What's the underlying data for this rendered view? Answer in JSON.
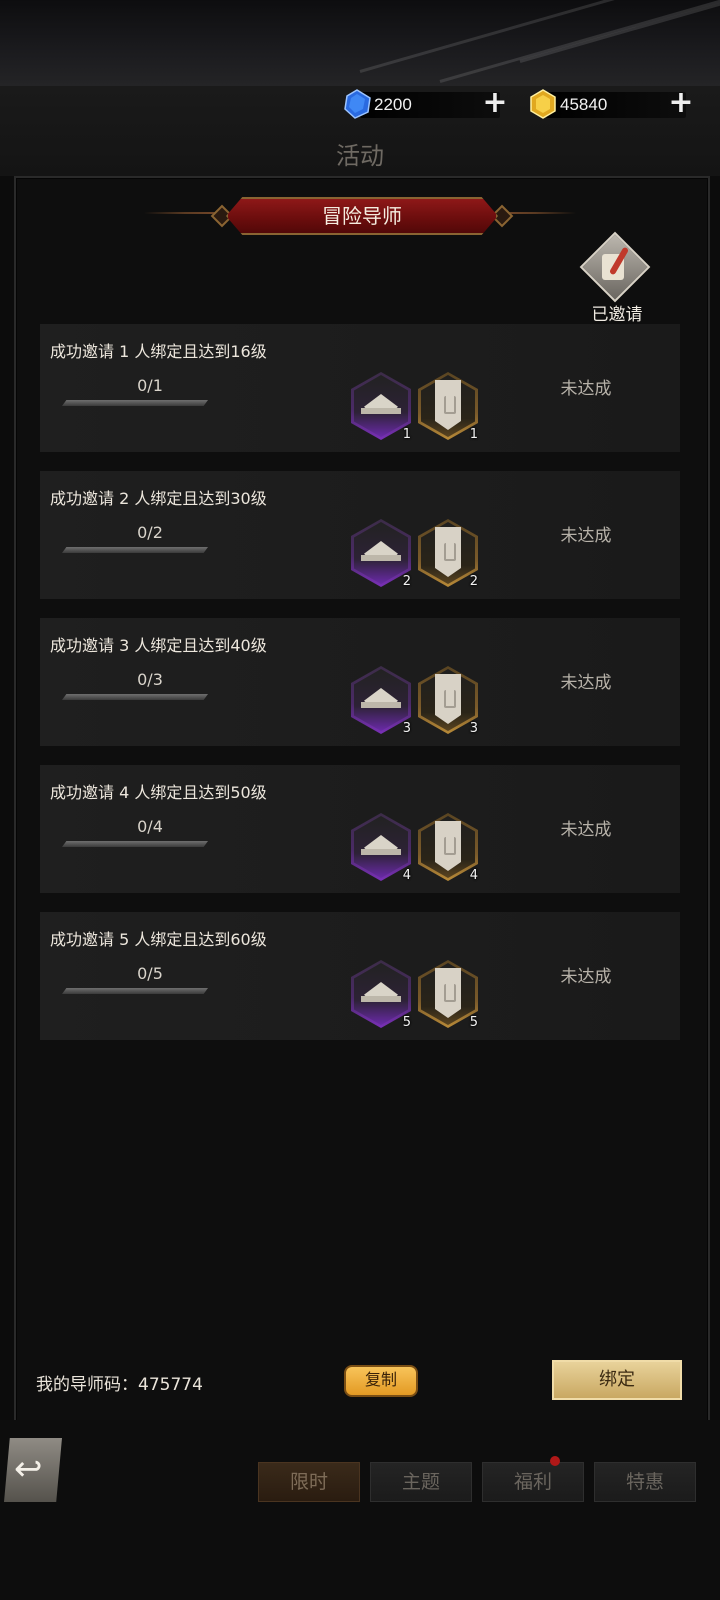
{
  "currency": {
    "gems": "2200",
    "gold": "45840"
  },
  "page_title": "活动",
  "banner_title": "冒险导师",
  "invited_label": "已邀请",
  "tasks": [
    {
      "title": "成功邀请 1 人绑定且达到16级",
      "progress": "0/1",
      "reward1_count": "1",
      "reward2_count": "1",
      "status": "未达成"
    },
    {
      "title": "成功邀请 2 人绑定且达到30级",
      "progress": "0/2",
      "reward1_count": "2",
      "reward2_count": "2",
      "status": "未达成"
    },
    {
      "title": "成功邀请 3 人绑定且达到40级",
      "progress": "0/3",
      "reward1_count": "3",
      "reward2_count": "3",
      "status": "未达成"
    },
    {
      "title": "成功邀请 4 人绑定且达到50级",
      "progress": "0/4",
      "reward1_count": "4",
      "reward2_count": "4",
      "status": "未达成"
    },
    {
      "title": "成功邀请 5 人绑定且达到60级",
      "progress": "0/5",
      "reward1_count": "5",
      "reward2_count": "5",
      "status": "未达成"
    }
  ],
  "footer": {
    "mentor_code": "我的导师码：475774",
    "copy_label": "复制",
    "bind_label": "绑定"
  },
  "tabs": [
    {
      "label": "限时",
      "active": true
    },
    {
      "label": "主题",
      "active": false
    },
    {
      "label": "福利",
      "active": false
    },
    {
      "label": "特惠",
      "active": false
    }
  ],
  "colors": {
    "banner_red": "#8e1818",
    "gold_button": "#e39a24",
    "reward_purple": "#7a30b8",
    "reward_gold": "#b88a38"
  }
}
